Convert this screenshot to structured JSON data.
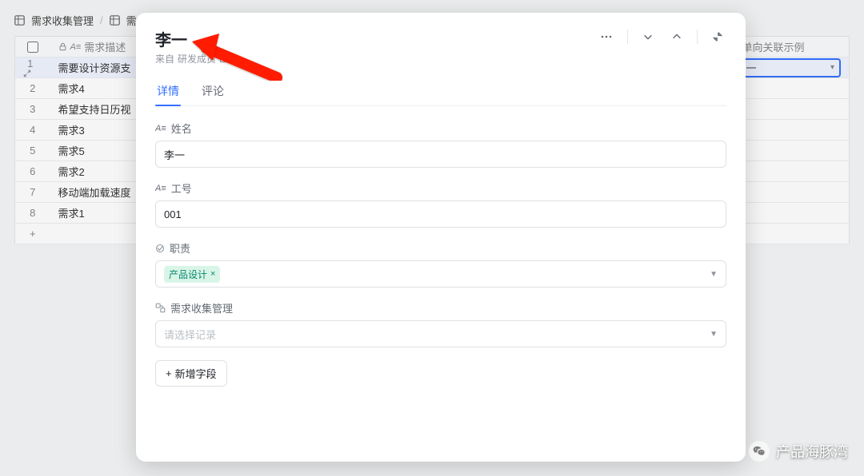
{
  "crumbs": {
    "first": "需求收集管理",
    "second": "需求"
  },
  "table": {
    "col_desc": "需求描述",
    "col_link": "单向关联示例",
    "rows": [
      {
        "idx": 1,
        "name": "需要设计资源支",
        "link": "李一",
        "selected": true
      },
      {
        "idx": 2,
        "name": "需求4"
      },
      {
        "idx": 3,
        "name": "希望支持日历视"
      },
      {
        "idx": 4,
        "name": "需求3"
      },
      {
        "idx": 5,
        "name": "需求5"
      },
      {
        "idx": 6,
        "name": "需求2"
      },
      {
        "idx": 7,
        "name": "移动端加载速度"
      },
      {
        "idx": 8,
        "name": "需求1"
      }
    ],
    "add_icon": "+"
  },
  "modal": {
    "title": "李一",
    "from_label": "来自",
    "from_target": "研发成员",
    "tabs": {
      "detail": "详情",
      "comment": "评论"
    },
    "fields": {
      "name_label": "姓名",
      "name_value": "李一",
      "id_label": "工号",
      "id_value": "001",
      "role_label": "职责",
      "role_tag": "产品设计",
      "link_label": "需求收集管理",
      "link_placeholder": "请选择记录"
    },
    "add_field": "新增字段"
  },
  "watermark": "产品海豚湾"
}
